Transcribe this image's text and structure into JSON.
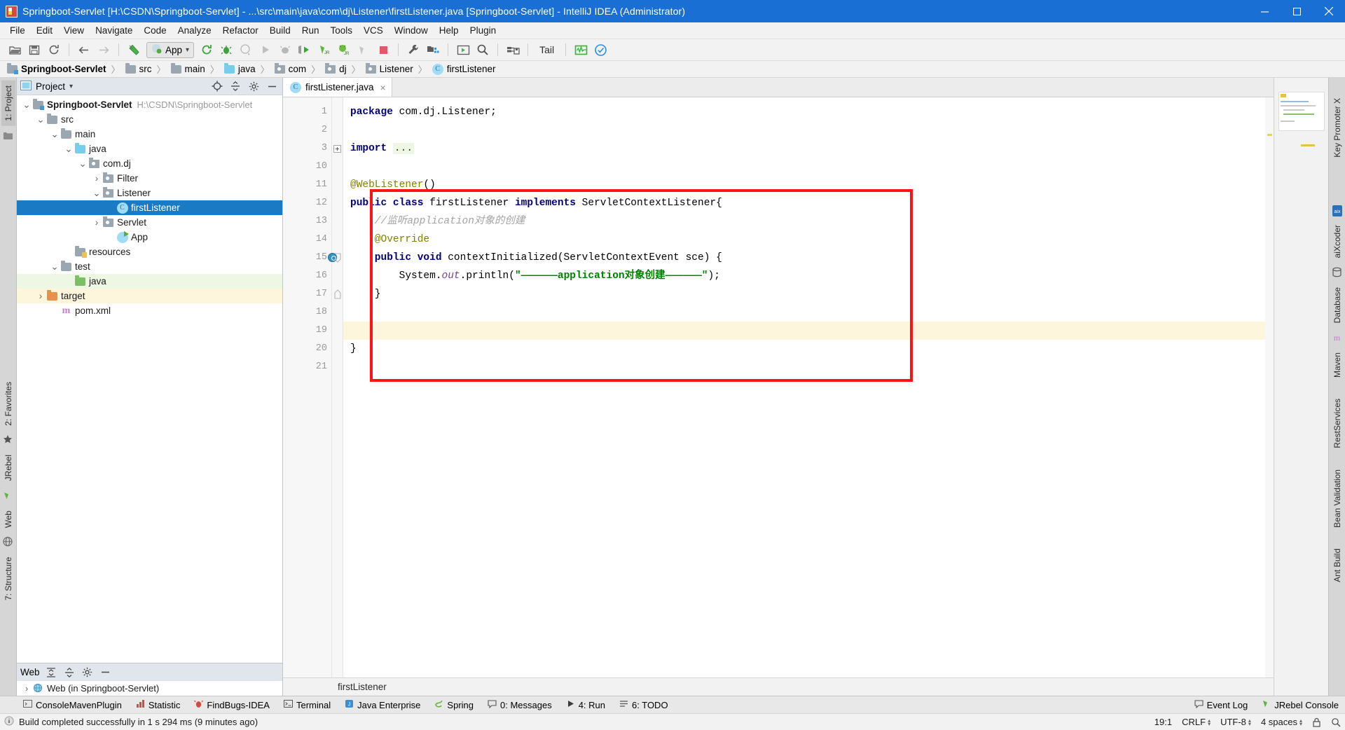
{
  "titlebar": {
    "title": "Springboot-Servlet [H:\\CSDN\\Springboot-Servlet] - ...\\src\\main\\java\\com\\dj\\Listener\\firstListener.java [Springboot-Servlet] - IntelliJ IDEA (Administrator)",
    "minimize": "minimize-button",
    "maximize": "maximize-button",
    "close": "close-button"
  },
  "menubar": {
    "items": [
      "File",
      "Edit",
      "View",
      "Navigate",
      "Code",
      "Analyze",
      "Refactor",
      "Build",
      "Run",
      "Tools",
      "VCS",
      "Window",
      "Help",
      "Plugin"
    ]
  },
  "toolbar": {
    "run_config": "App",
    "tail_label": "Tail",
    "icons": [
      "open-folder-icon",
      "save-all-icon",
      "sync-icon",
      "back-arrow-icon",
      "forward-arrow-icon",
      "build-hammer-icon",
      "rerun-icon",
      "debug-icon",
      "run-with-coverage-icon",
      "run-icon",
      "stop-profile-icon",
      "debug-green-icon",
      "jrebel-run-icon",
      "jrebel-debug-icon",
      "jrebel-disabled-icon",
      "stop-icon",
      "settings-wrench-icon",
      "project-structure-icon",
      "update-app-icon",
      "search-everywhere-icon",
      "deploy-icon",
      "tail-log-icon",
      "monitor-icon",
      "check-circle-icon"
    ]
  },
  "breadcrumb": {
    "items": [
      {
        "label": "Springboot-Servlet",
        "icon": "project-folder-icon",
        "bold": true
      },
      {
        "label": "src",
        "icon": "folder-icon",
        "bold": false
      },
      {
        "label": "main",
        "icon": "folder-icon",
        "bold": false
      },
      {
        "label": "java",
        "icon": "source-folder-icon",
        "bold": false
      },
      {
        "label": "com",
        "icon": "package-icon",
        "bold": false
      },
      {
        "label": "dj",
        "icon": "package-icon",
        "bold": false
      },
      {
        "label": "Listener",
        "icon": "package-icon",
        "bold": false
      },
      {
        "label": "firstListener",
        "icon": "class-icon",
        "bold": false
      }
    ],
    "separator": "〉"
  },
  "left_strip": {
    "tabs": [
      "1: Project",
      "2: Favorites",
      "JRebel",
      "Web",
      "7: Structure"
    ]
  },
  "right_strip": {
    "tabs": [
      "Key Promoter X",
      "aiXcoder",
      "Database",
      "Maven",
      "RestServices",
      "Bean Validation",
      "Ant Build"
    ]
  },
  "project_panel": {
    "title": "Project",
    "dropdown": "▾",
    "locate_icon": "locate-target-icon",
    "collapse_icon": "collapse-all-icon",
    "settings_icon": "gear-icon",
    "hide_icon": "hide-panel-icon",
    "tree": [
      {
        "label": "Springboot-Servlet",
        "sub": "H:\\CSDN\\Springboot-Servlet",
        "indent": 0,
        "arrow": "down",
        "icon": "project-folder-icon",
        "state": "normal",
        "bold": true
      },
      {
        "label": "src",
        "sub": "",
        "indent": 1,
        "arrow": "down",
        "icon": "folder-icon",
        "state": "normal",
        "bold": false
      },
      {
        "label": "main",
        "sub": "",
        "indent": 2,
        "arrow": "down",
        "icon": "folder-icon",
        "state": "normal",
        "bold": false
      },
      {
        "label": "java",
        "sub": "",
        "indent": 3,
        "arrow": "down",
        "icon": "source-folder-icon",
        "state": "normal",
        "bold": false
      },
      {
        "label": "com.dj",
        "sub": "",
        "indent": 4,
        "arrow": "down",
        "icon": "package-icon",
        "state": "normal",
        "bold": false
      },
      {
        "label": "Filter",
        "sub": "",
        "indent": 5,
        "arrow": "right",
        "icon": "package-icon",
        "state": "normal",
        "bold": false
      },
      {
        "label": "Listener",
        "sub": "",
        "indent": 5,
        "arrow": "down",
        "icon": "package-icon",
        "state": "normal",
        "bold": false
      },
      {
        "label": "firstListener",
        "sub": "",
        "indent": 6,
        "arrow": "none",
        "icon": "class-icon",
        "state": "selected",
        "bold": false
      },
      {
        "label": "Servlet",
        "sub": "",
        "indent": 5,
        "arrow": "right",
        "icon": "package-icon",
        "state": "normal",
        "bold": false
      },
      {
        "label": "App",
        "sub": "",
        "indent": 6,
        "arrow": "none",
        "icon": "runnable-class-icon",
        "state": "normal",
        "bold": false
      },
      {
        "label": "resources",
        "sub": "",
        "indent": 3,
        "arrow": "none",
        "icon": "resources-folder-icon",
        "state": "normal",
        "bold": false
      },
      {
        "label": "test",
        "sub": "",
        "indent": 2,
        "arrow": "down",
        "icon": "folder-icon",
        "state": "normal",
        "bold": false
      },
      {
        "label": "java",
        "sub": "",
        "indent": 3,
        "arrow": "none",
        "icon": "test-source-folder-icon",
        "state": "green",
        "bold": false
      },
      {
        "label": "target",
        "sub": "",
        "indent": 1,
        "arrow": "right",
        "icon": "excluded-folder-icon",
        "state": "yellow",
        "bold": false
      },
      {
        "label": "pom.xml",
        "sub": "",
        "indent": 2,
        "arrow": "none",
        "icon": "maven-file-icon",
        "state": "normal",
        "bold": false
      }
    ]
  },
  "web_panel": {
    "title": "Web",
    "expand_icon": "expand-all-icon",
    "collapse_icon": "collapse-all-icon",
    "settings_icon": "gear-icon",
    "hide_icon": "hide-panel-icon",
    "items": [
      {
        "label": "Web (in Springboot-Servlet)",
        "arrow": "right",
        "icon": "web-facet-icon"
      }
    ]
  },
  "editor": {
    "tab": {
      "label": "firstListener.java",
      "icon": "class-icon",
      "close": "×"
    },
    "footer_breadcrumb": "firstListener",
    "lines": [
      {
        "num": "1",
        "indent": 0,
        "html_key": "l1",
        "breakpoint": false,
        "fold": "",
        "highlight": false
      },
      {
        "num": "2",
        "indent": 0,
        "html_key": "l2",
        "breakpoint": false,
        "fold": "",
        "highlight": false
      },
      {
        "num": "3",
        "indent": 0,
        "html_key": "l3",
        "breakpoint": false,
        "fold": "plus",
        "highlight": false
      },
      {
        "num": "10",
        "indent": 0,
        "html_key": "l10",
        "breakpoint": false,
        "fold": "",
        "highlight": false
      },
      {
        "num": "11",
        "indent": 0,
        "html_key": "l11",
        "breakpoint": false,
        "fold": "",
        "highlight": false
      },
      {
        "num": "12",
        "indent": 0,
        "html_key": "l12",
        "breakpoint": false,
        "fold": "",
        "highlight": false
      },
      {
        "num": "13",
        "indent": 0,
        "html_key": "l13",
        "breakpoint": false,
        "fold": "",
        "highlight": false
      },
      {
        "num": "14",
        "indent": 0,
        "html_key": "l14",
        "breakpoint": false,
        "fold": "",
        "highlight": false
      },
      {
        "num": "15",
        "indent": 0,
        "html_key": "l15",
        "breakpoint": true,
        "fold": "open",
        "highlight": false
      },
      {
        "num": "16",
        "indent": 0,
        "html_key": "l16",
        "breakpoint": false,
        "fold": "",
        "highlight": false
      },
      {
        "num": "17",
        "indent": 0,
        "html_key": "l17",
        "breakpoint": false,
        "fold": "close",
        "highlight": false
      },
      {
        "num": "18",
        "indent": 0,
        "html_key": "l18",
        "breakpoint": false,
        "fold": "",
        "highlight": false
      },
      {
        "num": "19",
        "indent": 0,
        "html_key": "l19",
        "breakpoint": false,
        "fold": "",
        "highlight": true
      },
      {
        "num": "20",
        "indent": 0,
        "html_key": "l20",
        "breakpoint": false,
        "fold": "",
        "highlight": false
      },
      {
        "num": "21",
        "indent": 0,
        "html_key": "l21",
        "breakpoint": false,
        "fold": "",
        "highlight": false
      }
    ],
    "source_text": {
      "l1": "package com.dj.Listener;",
      "l2": "",
      "l3": "import ...",
      "l10": "",
      "l11": "@WebListener()",
      "l12": "public class firstListener implements ServletContextListener{",
      "l13": "    //监听application对象的创建",
      "l14": "    @Override",
      "l15": "    public void contextInitialized(ServletContextEvent sce) {",
      "l16": "        System.out.println(\"——————application对象创建——————\");",
      "l17": "    }",
      "l18": "",
      "l19": "",
      "l20": "}",
      "l21": ""
    },
    "annotation_box": {
      "name": "red-highlight-rectangle",
      "color": "#fb1414"
    }
  },
  "bottom_tabs": [
    {
      "label": "ConsoleMavenPlugin",
      "icon": "console-icon"
    },
    {
      "label": "Statistic",
      "icon": "statistic-icon"
    },
    {
      "label": "FindBugs-IDEA",
      "icon": "findbugs-icon"
    },
    {
      "label": "Terminal",
      "icon": "terminal-icon"
    },
    {
      "label": "Java Enterprise",
      "icon": "java-enterprise-icon"
    },
    {
      "label": "Spring",
      "icon": "spring-icon"
    },
    {
      "label": "0: Messages",
      "icon": "messages-icon"
    },
    {
      "label": "4: Run",
      "icon": "run-icon"
    },
    {
      "label": "6: TODO",
      "icon": "todo-icon"
    }
  ],
  "bottom_tabs_right": [
    {
      "label": "Event Log",
      "icon": "event-log-icon"
    },
    {
      "label": "JRebel Console",
      "icon": "jrebel-icon"
    }
  ],
  "statusbar": {
    "message": "Build completed successfully in 1 s 294 ms (9 minutes ago)",
    "message_icon": "info-icon",
    "caret": "19:1",
    "line_separator": "CRLF",
    "encoding": "UTF-8",
    "indent": "4 spaces",
    "lock_icon": "lock-icon",
    "inspection_icon": "inspection-icon"
  },
  "colors": {
    "title_bg": "#1a6fd4",
    "selection_blue": "#1a7bc4",
    "annotation_red": "#fb1414",
    "keyword_navy": "#000080",
    "annotation_olive": "#808000",
    "string_green": "#008000",
    "comment_grey": "#a3a3a3"
  }
}
